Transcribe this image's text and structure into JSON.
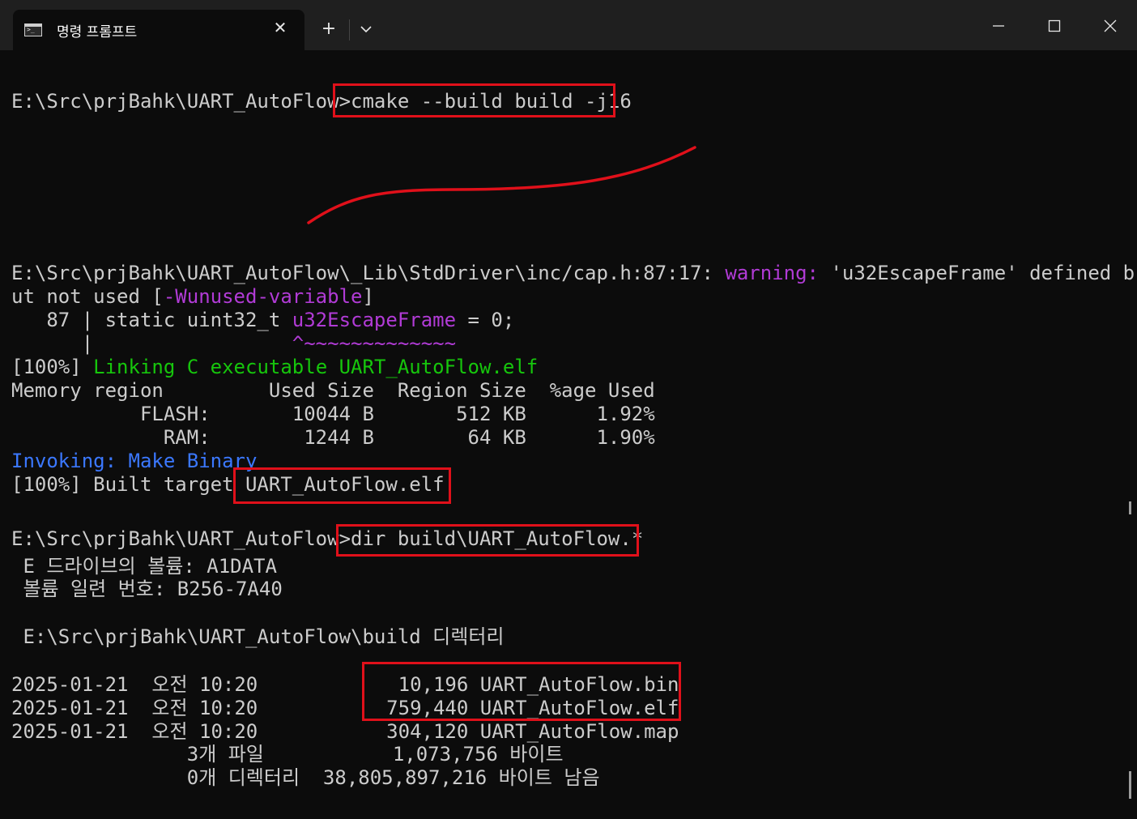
{
  "window": {
    "tab_title": "명령 프롬프트",
    "tab_close_glyph": "✕",
    "new_tab_glyph": "+",
    "icons": [
      "command-prompt-icon",
      "close-icon",
      "plus-icon",
      "chevron-down-icon",
      "minimize-icon",
      "maximize-icon",
      "close-window-icon"
    ]
  },
  "colors": {
    "warning": "#b13bd6",
    "success": "#16c60c",
    "info": "#3b78ff",
    "highlight_box": "#e0101a",
    "background": "#0c0c0c"
  },
  "terminal": {
    "cmd1_prompt": "E:\\Src\\prjBahk\\UART_AutoFlow>",
    "cmd1_command": "cmake --build build -j16",
    "warn_path": "E:\\Src\\prjBahk\\UART_AutoFlow\\_Lib\\StdDriver\\inc/cap.h:87:17: ",
    "warn_label": "warning:",
    "warn_msg": " 'u32EscapeFrame' defined b",
    "warn_cont1": "ut not used [",
    "warn_flag": "-Wunused-variable",
    "warn_cont2": "]",
    "code_prefix": "   87 | static uint32_t ",
    "code_var": "u32EscapeFrame",
    "code_suffix": " = 0;",
    "caret_prefix": "      |                 ",
    "caret_marks": "^~~~~~~~~~~~~~",
    "link_prefix": "[100%] ",
    "link_msg": "Linking C executable UART_AutoFlow.elf",
    "mem_header": "Memory region         Used Size  Region Size  %age Used",
    "mem_flash": "           FLASH:       10044 B       512 KB      1.92%",
    "mem_ram": "             RAM:        1244 B        64 KB      1.90%",
    "invoking": "Invoking: Make Binary",
    "built_prefix": "[100%] Built target ",
    "built_target": "UART_AutoFlow.elf",
    "cmd2_prompt": "E:\\Src\\prjBahk\\UART_AutoFlow>",
    "cmd2_command": "dir build\\UART_AutoFlow.*",
    "vol_label": " E 드라이브의 볼륨: A1DATA",
    "vol_serial": " 볼륨 일련 번호: B256-7A40",
    "dir_of": " E:\\Src\\prjBahk\\UART_AutoFlow\\build 디렉터리",
    "files": [
      "2025-01-21  오전 10:20            10,196 UART_AutoFlow.bin",
      "2025-01-21  오전 10:20           759,440 UART_AutoFlow.elf",
      "2025-01-21  오전 10:20           304,120 UART_AutoFlow.map"
    ],
    "summary_files": "               3개 파일           1,073,756 바이트",
    "summary_dirs": "               0개 디렉터리  38,805,897,216 바이트 남음"
  }
}
